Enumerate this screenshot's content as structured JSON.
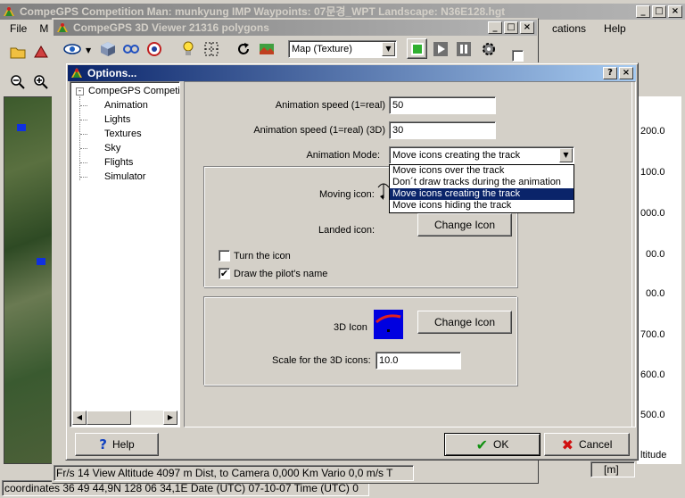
{
  "main_window": {
    "title": "CompeGPS Competition Man: munkyung IMP Waypoints:  07문경_WPT Landscape: N36E128.hgt",
    "menu": [
      "File",
      "M",
      "cations",
      "Help"
    ],
    "status_coordinates": "coordinates 36 49 44,9N 128 06 34,1E Date (UTC) 07-10-07 Time (UTC) 0"
  },
  "right_axis": {
    "labels": [
      "200.0",
      "100.0",
      "000.0",
      "00.0",
      "00.0",
      "700.0",
      "600.0",
      "500.0",
      "ltitude"
    ],
    "unit": "[m]"
  },
  "viewer_window": {
    "title": "CompeGPS 3D Viewer 21316 polygons",
    "map_mode": "Map (Texture)",
    "status": "Fr/s 14 View Altitude 4097 m Dist, to Camera 0,000 Km Vario 0,0 m/s T"
  },
  "dialog": {
    "title": "Options...",
    "help_btn": "?",
    "close_btn": "×",
    "tree": {
      "root": "CompeGPS Competit",
      "children": [
        "Animation",
        "Lights",
        "Textures",
        "Sky",
        "Flights",
        "Simulator"
      ]
    },
    "anim_speed_label": "Animation speed (1=real)",
    "anim_speed_value": "50",
    "anim_speed_3d_label": "Animation speed (1=real) (3D)",
    "anim_speed_3d_value": "30",
    "anim_mode_label": "Animation Mode:",
    "anim_mode_value": "Move icons creating the track",
    "anim_mode_options": [
      "Move icons over the track",
      "Don´t draw tracks during the animation",
      "Move icons creating the track",
      "Move icons hiding the track"
    ],
    "anim_mode_selected_index": 2,
    "moving_icon_label": "Moving icon:",
    "landed_icon_label": "Landed icon:",
    "change_icon_label": "Change Icon",
    "turn_icon_label": "Turn the icon",
    "turn_icon_checked": false,
    "draw_pilot_label": "Draw the pilot's name",
    "draw_pilot_checked": true,
    "icon3d_label": "3D Icon",
    "scale_label": "Scale for the 3D icons:",
    "scale_value": "10.0",
    "help_label": "Help",
    "ok_label": "OK",
    "cancel_label": "Cancel"
  }
}
